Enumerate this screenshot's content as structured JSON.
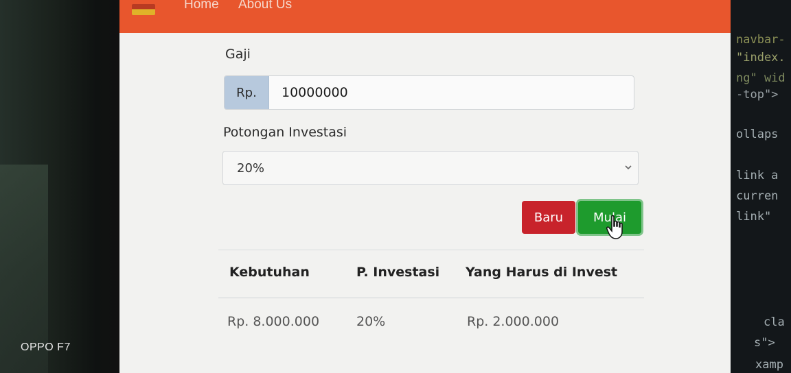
{
  "watermark": "OPPO F7",
  "nav": {
    "links": [
      "Home",
      "About Us"
    ]
  },
  "form": {
    "gaji_label": "Gaji",
    "gaji_addon": "Rp.",
    "gaji_value": "10000000",
    "investasi_label": "Potongan Investasi",
    "investasi_selected": "20%"
  },
  "buttons": {
    "baru": "Baru",
    "mulai": "Mulai"
  },
  "table": {
    "headers": [
      "Kebutuhan",
      "P. Investasi",
      "Yang Harus di Invest"
    ],
    "row": [
      "Rp. 8.000.000",
      "20%",
      "Rp. 2.000.000"
    ]
  },
  "code_snippets": [
    {
      "text": "navbar-",
      "color": "#8a8f55"
    },
    {
      "text": "\"index.",
      "color": "#9aa06a"
    },
    {
      "text": "ng\" wid",
      "color": "#7e8a5e"
    },
    {
      "text": "-top\">",
      "color": "#9aa2a6"
    },
    {
      "text": "ollaps",
      "color": "#a6b0b4"
    },
    {
      "text": "link a",
      "color": "#a6b0b4"
    },
    {
      "text": "curren",
      "color": "#a6b0b4"
    },
    {
      "text": "link\"",
      "color": "#a6b0b4"
    },
    {
      "text": "cla",
      "color": "#a6b0b4"
    },
    {
      "text": "s\">",
      "color": "#a6b0b4"
    },
    {
      "text": "xamp",
      "color": "#a6b0b4"
    }
  ],
  "colors": {
    "navbar": "#e8562d",
    "btn_baru": "#c8232b",
    "btn_mulai": "#1e9b2d"
  },
  "icons": {
    "select_arrow": "chevron-down-icon",
    "cursor": "hand-pointer-icon"
  }
}
